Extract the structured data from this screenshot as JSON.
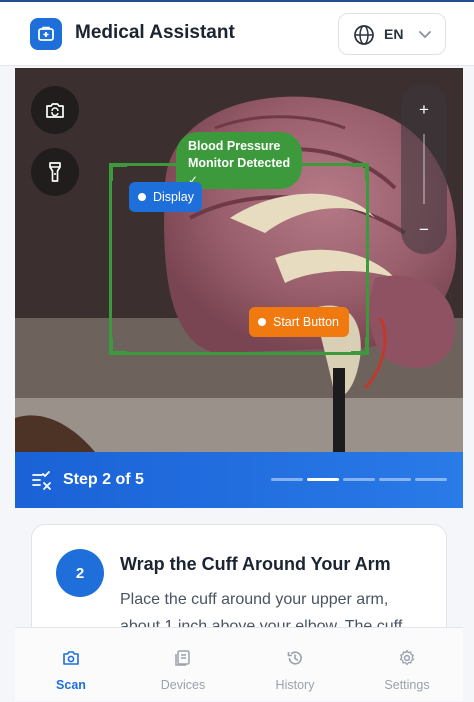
{
  "header": {
    "title": "Medical Assistant",
    "language": "EN"
  },
  "camera": {
    "detection_label": "Blood Pressure Monitor Detected",
    "detection_check": "✓",
    "markers": {
      "display": "Display",
      "start_button": "Start Button"
    },
    "zoom_in": "+",
    "zoom_out": "−"
  },
  "progress": {
    "label": "Step 2 of 5",
    "current_step": 2,
    "total_steps": 5
  },
  "instruction": {
    "number": "2",
    "title": "Wrap the Cuff Around Your Arm",
    "body": "Place the cuff around your upper arm, about 1 inch above your elbow. The cuff"
  },
  "nav": {
    "items": [
      {
        "label": "Scan",
        "icon": "camera-icon",
        "active": true
      },
      {
        "label": "Devices",
        "icon": "devices-icon",
        "active": false
      },
      {
        "label": "History",
        "icon": "history-icon",
        "active": false
      },
      {
        "label": "Settings",
        "icon": "gear-icon",
        "active": false
      }
    ]
  },
  "colors": {
    "primary": "#1e6fd9",
    "detected": "#3c9a3c",
    "marker_orange": "#f07a10"
  }
}
